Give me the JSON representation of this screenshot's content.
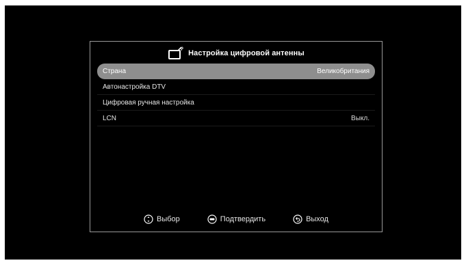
{
  "dialog": {
    "title": "Настройка цифровой антенны",
    "title_icon": "antenna-tv-icon"
  },
  "menu": {
    "items": [
      {
        "label": "Страна",
        "value": "Великобритания",
        "selected": true
      },
      {
        "label": "Автонастройка DTV",
        "value": ""
      },
      {
        "label": "Цифровая ручная настройка",
        "value": ""
      },
      {
        "label": "LCN",
        "value": "Выкл."
      }
    ]
  },
  "footer": {
    "select_label": "Выбор",
    "select_icon": "navigate-icon",
    "confirm_label": "Подтвердить",
    "confirm_icon": "enter-icon",
    "exit_label": "Выход",
    "exit_icon": "back-icon"
  },
  "colors": {
    "background": "#000000",
    "highlight": "#8e8e8e",
    "border": "#9a9a9a",
    "text": "#e6e6e6"
  }
}
